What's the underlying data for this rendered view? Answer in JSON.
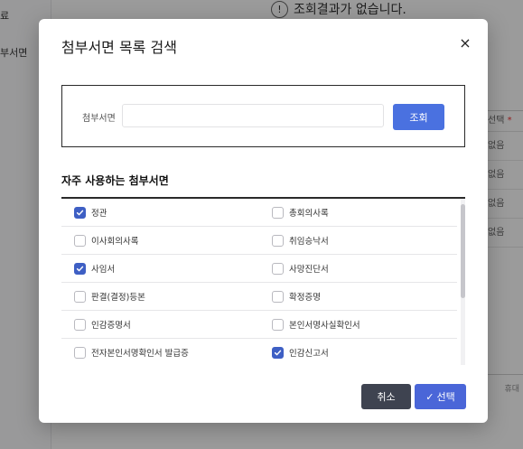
{
  "background": {
    "sidebar_items": [
      "료",
      "부서면"
    ],
    "empty_icon": "!",
    "empty_text": "조회결과가 없습니다.",
    "column_header": "선택",
    "column_required_mark": "*",
    "column_cells": [
      "없음",
      "없음",
      "없음",
      "없음"
    ],
    "footer_text": "휴대"
  },
  "modal": {
    "title": "첨부서면 목록 검색",
    "close_icon": "×",
    "search": {
      "label": "첨부서면",
      "value": "",
      "placeholder": "",
      "button_label": "조회"
    },
    "section_title": "자주 사용하는 첨부서면",
    "items": [
      {
        "label": "정관",
        "checked": true
      },
      {
        "label": "총회의사록",
        "checked": false
      },
      {
        "label": "이사회의사록",
        "checked": false
      },
      {
        "label": "취임승낙서",
        "checked": false
      },
      {
        "label": "사임서",
        "checked": true
      },
      {
        "label": "사망진단서",
        "checked": false
      },
      {
        "label": "판결(결정)등본",
        "checked": false
      },
      {
        "label": "확정증명",
        "checked": false
      },
      {
        "label": "인감증명서",
        "checked": false
      },
      {
        "label": "본인서명사실확인서",
        "checked": false
      },
      {
        "label": "전자본인서명확인서 발급증",
        "checked": false
      },
      {
        "label": "인감신고서",
        "checked": true
      }
    ],
    "cancel_label": "취소",
    "select_icon": "✓",
    "select_label": "선택"
  },
  "colors": {
    "primary": "#4a71e0",
    "checkbox_checked": "#3e5fc4",
    "cancel_button": "#3e4350"
  }
}
